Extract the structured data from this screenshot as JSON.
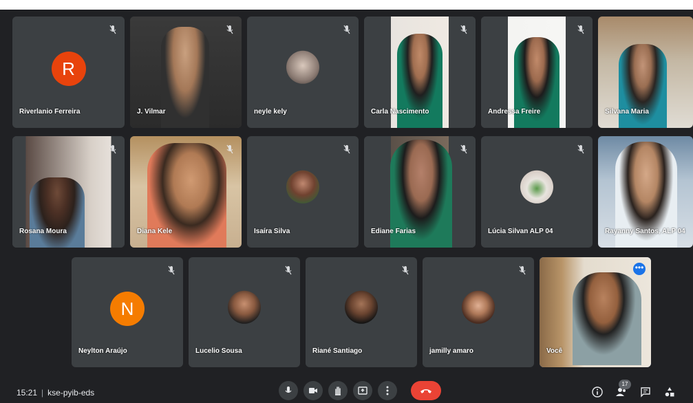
{
  "participants": [
    {
      "name": "Riverlanio Ferreira",
      "initial": "R",
      "avatar_color": "#e8430c",
      "kind": "letter"
    },
    {
      "name": "J. Vilmar",
      "kind": "video"
    },
    {
      "name": "neyle kely",
      "kind": "photo"
    },
    {
      "name": "Carla Nascimento",
      "kind": "video"
    },
    {
      "name": "Andressa Freire",
      "kind": "video"
    },
    {
      "name": "Silvana Maria",
      "kind": "video"
    },
    {
      "name": "Rosana Moura",
      "kind": "video"
    },
    {
      "name": "Diana Kele",
      "kind": "video"
    },
    {
      "name": "Isaíra Silva",
      "kind": "photo"
    },
    {
      "name": "Ediane Farias",
      "kind": "video"
    },
    {
      "name": "Lúcia Silvan ALP 04",
      "kind": "photo"
    },
    {
      "name": "Rayanny Santos, ALP 04",
      "kind": "video"
    },
    {
      "name": "Neylton Araújo",
      "initial": "N",
      "avatar_color": "#f57c00",
      "kind": "letter"
    },
    {
      "name": "Lucelio Sousa",
      "kind": "photo"
    },
    {
      "name": "Riané Santiago",
      "kind": "photo"
    },
    {
      "name": "jamilly amaro",
      "kind": "photo"
    },
    {
      "name": "Você",
      "kind": "self"
    }
  ],
  "meeting": {
    "time": "15:21",
    "separator": "|",
    "code": "kse-pyib-eds"
  },
  "controls": {
    "participants_count": "17"
  },
  "colors": {
    "background": "#202124",
    "tile": "#3c4043",
    "hangup": "#ea4335",
    "self_outline": "#8ab4f8"
  }
}
